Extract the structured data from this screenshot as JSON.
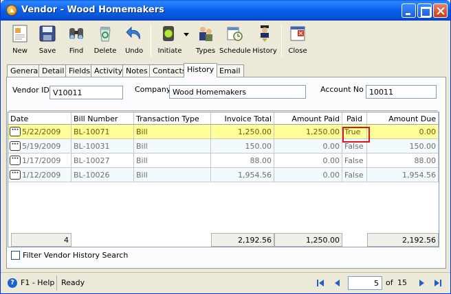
{
  "window": {
    "title": "Vendor - Wood Homemakers"
  },
  "toolbar": {
    "new_label": "New",
    "save_label": "Save",
    "find_label": "Find",
    "delete_label": "Delete",
    "undo_label": "Undo",
    "initiate_label": "Initiate",
    "types_label": "Types",
    "schedule_label": "Schedule",
    "history_label": "History",
    "close_label": "Close"
  },
  "tabs": [
    "General",
    "Detail",
    "Fields",
    "Activity",
    "Notes",
    "Contacts",
    "History",
    "Email"
  ],
  "active_tab": "History",
  "form": {
    "vendor_id_label": "Vendor ID",
    "vendor_id_value": "V10011",
    "company_label": "Company",
    "company_value": "Wood Homemakers",
    "account_no_label": "Account No",
    "account_no_value": "10011"
  },
  "grid": {
    "columns": [
      "Date",
      "Bill Number",
      "Transaction Type",
      "Invoice Total",
      "Amount Paid",
      "Paid",
      "Amount Due"
    ],
    "rows": [
      {
        "date": "5/22/2009",
        "bill": "BL-10071",
        "type": "Bill",
        "invoice": "1,250.00",
        "paid_amt": "1,250.00",
        "paid": "True",
        "due": "0.00"
      },
      {
        "date": "5/19/2009",
        "bill": "BL-10031",
        "type": "Bill",
        "invoice": "150.00",
        "paid_amt": "0.00",
        "paid": "False",
        "due": "150.00"
      },
      {
        "date": "1/17/2009",
        "bill": "BL-10027",
        "type": "Bill",
        "invoice": "88.00",
        "paid_amt": "0.00",
        "paid": "False",
        "due": "88.00"
      },
      {
        "date": "1/12/2009",
        "bill": "BL-10026",
        "type": "Bill",
        "invoice": "1,954.56",
        "paid_amt": "0.00",
        "paid": "False",
        "due": "1,954.56"
      }
    ],
    "totals": {
      "count": "4",
      "invoice": "2,192.56",
      "paid_amt": "1,250.00",
      "due": "2,192.56"
    }
  },
  "filter": {
    "label": "Filter Vendor History Search"
  },
  "status": {
    "help": "F1 - Help",
    "state": "Ready",
    "page": "5",
    "of_label": "of",
    "total_pages": "15"
  },
  "colors": {
    "title_bar": "#0A5FE8",
    "selected_row": "#ffff99",
    "highlight_border": "#d9141c"
  }
}
